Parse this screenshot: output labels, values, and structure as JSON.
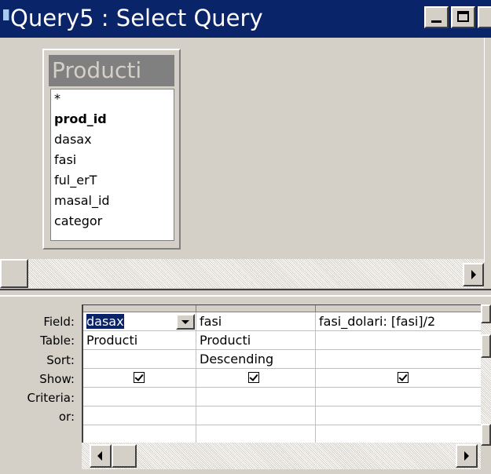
{
  "window": {
    "title": "Query5 : Select Query",
    "controls": [
      "minimize-icon",
      "maximize-icon",
      "close-icon"
    ]
  },
  "field_list": {
    "table_name": "Producti",
    "fields": [
      "*",
      "prod_id",
      "dasax",
      "fasi",
      "ful_erT",
      "masal_id",
      "categor"
    ],
    "key_field": "prod_id"
  },
  "grid": {
    "row_labels": {
      "field": "Field:",
      "table": "Table:",
      "sort": "Sort:",
      "show": "Show:",
      "criteria": "Criteria:",
      "or": "or:"
    },
    "columns": [
      {
        "field": "dasax",
        "table": "Producti",
        "sort": "",
        "show": true,
        "criteria": "",
        "or": ""
      },
      {
        "field": "fasi",
        "table": "Producti",
        "sort": "Descending",
        "show": true,
        "criteria": "",
        "or": ""
      },
      {
        "field": "fasi_dolari: [fasi]/2",
        "table": "",
        "sort": "",
        "show": true,
        "criteria": "",
        "or": ""
      }
    ]
  }
}
